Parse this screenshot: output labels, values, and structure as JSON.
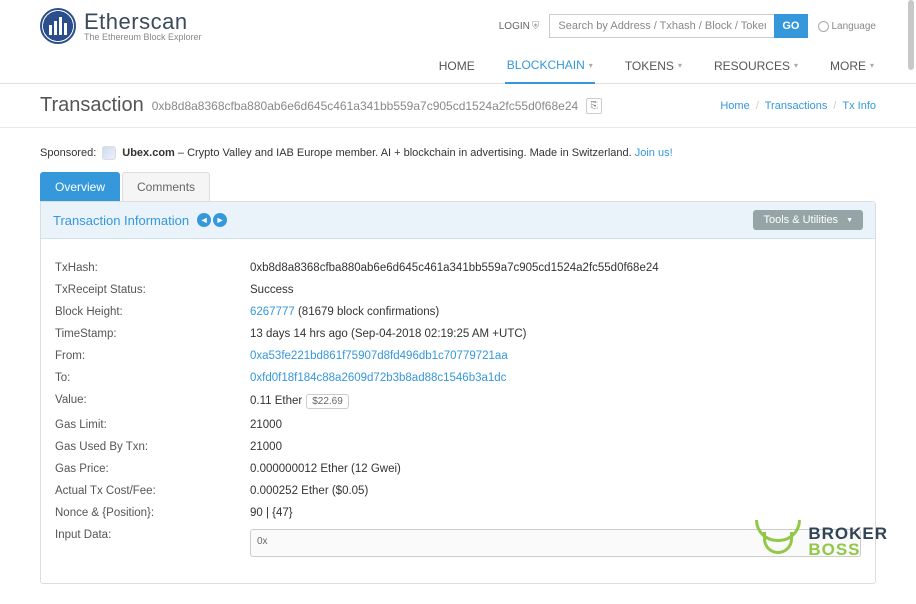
{
  "logo": {
    "brand": "Etherscan",
    "sub": "The Ethereum Block Explorer"
  },
  "login": "LOGIN",
  "search": {
    "placeholder": "Search by Address / Txhash / Block / Token / Ens",
    "go": "GO"
  },
  "language": "Language",
  "nav": [
    "HOME",
    "BLOCKCHAIN",
    "TOKENS",
    "RESOURCES",
    "MORE"
  ],
  "pageTitle": "Transaction",
  "txHashShort": "0xb8d8a8368cfba880ab6e6d645c461a341bb559a7c905cd1524a2fc55d0f68e24",
  "crumbs": {
    "home": "Home",
    "txs": "Transactions",
    "tx": "Tx Info"
  },
  "sponsored": {
    "label": "Sponsored:",
    "name": "Ubex.com",
    "text": " – Crypto Valley and IAB Europe member. AI + blockchain in advertising. Made in Switzerland. ",
    "link": "Join us!"
  },
  "tabs": {
    "overview": "Overview",
    "comments": "Comments"
  },
  "panel": {
    "title": "Transaction Information",
    "tools": "Tools & Utilities"
  },
  "rows": {
    "txhash": {
      "label": "TxHash:",
      "value": "0xb8d8a8368cfba880ab6e6d645c461a341bb559a7c905cd1524a2fc55d0f68e24"
    },
    "status": {
      "label": "TxReceipt Status:",
      "value": "Success"
    },
    "block": {
      "label": "Block Height:",
      "link": "6267777",
      "conf": " (81679 block confirmations)"
    },
    "time": {
      "label": "TimeStamp:",
      "value": "13 days 14 hrs ago (Sep-04-2018 02:19:25 AM +UTC)"
    },
    "from": {
      "label": "From:",
      "value": "0xa53fe221bd861f75907d8fd496db1c70779721aa"
    },
    "to": {
      "label": "To:",
      "value": "0xfd0f18f184c88a2609d72b3b8ad88c1546b3a1dc"
    },
    "value": {
      "label": "Value:",
      "eth": "0.11 Ether",
      "usd": "$22.69"
    },
    "gaslimit": {
      "label": "Gas Limit:",
      "value": "21000"
    },
    "gasused": {
      "label": "Gas Used By Txn:",
      "value": "21000"
    },
    "gasprice": {
      "label": "Gas Price:",
      "value": "0.000000012 Ether (12 Gwei)"
    },
    "cost": {
      "label": "Actual Tx Cost/Fee:",
      "value": "0.000252 Ether ($0.05)"
    },
    "nonce": {
      "label": "Nonce & {Position}:",
      "value": "90 | {47}"
    },
    "input": {
      "label": "Input Data:",
      "value": "0x"
    }
  },
  "watermark": {
    "l1": "BROKER",
    "l2": "BOSS"
  }
}
